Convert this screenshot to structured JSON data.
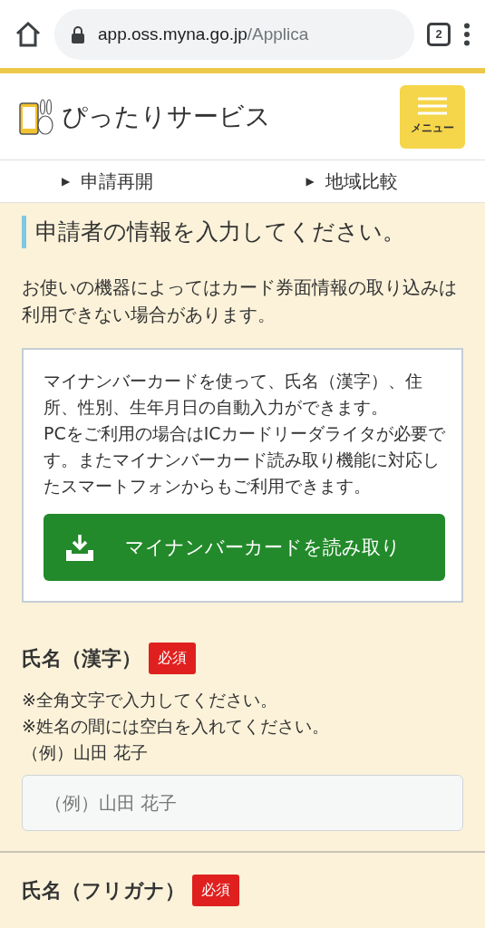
{
  "browser": {
    "url_host": "app.oss.myna.go.jp",
    "url_path": "/Applica",
    "tab_count": "2"
  },
  "header": {
    "site_title": "ぴったりサービス",
    "menu_label": "メニュー"
  },
  "subnav": [
    {
      "arrow": "▶",
      "label": "申請再開"
    },
    {
      "arrow": "▶",
      "label": "地域比較"
    }
  ],
  "page_heading": "申請者の情報を入力してください。",
  "notice": "お使いの機器によってはカード券面情報の取り込みは利用できない場合があります。",
  "card_reader": {
    "lines": [
      "マイナンバーカードを使って、氏名（漢字）、住所、性別、生年月日の自動入力ができます。",
      "PCをご利用の場合はICカードリーダライタが必要です。またマイナンバーカード読み取り機能に対応したスマートフォンからもご利用できます。"
    ],
    "button": "マイナンバーカードを読み取り"
  },
  "fields": [
    {
      "label": "氏名（漢字）",
      "required": true,
      "required_badge": "必須",
      "hints": [
        "※全角文字で入力してください。",
        "※姓名の間には空白を入れてください。",
        "（例）山田 花子"
      ],
      "placeholder": "（例）山田 花子"
    },
    {
      "label": "氏名（フリガナ）",
      "required": true,
      "required_badge": "必須"
    }
  ]
}
